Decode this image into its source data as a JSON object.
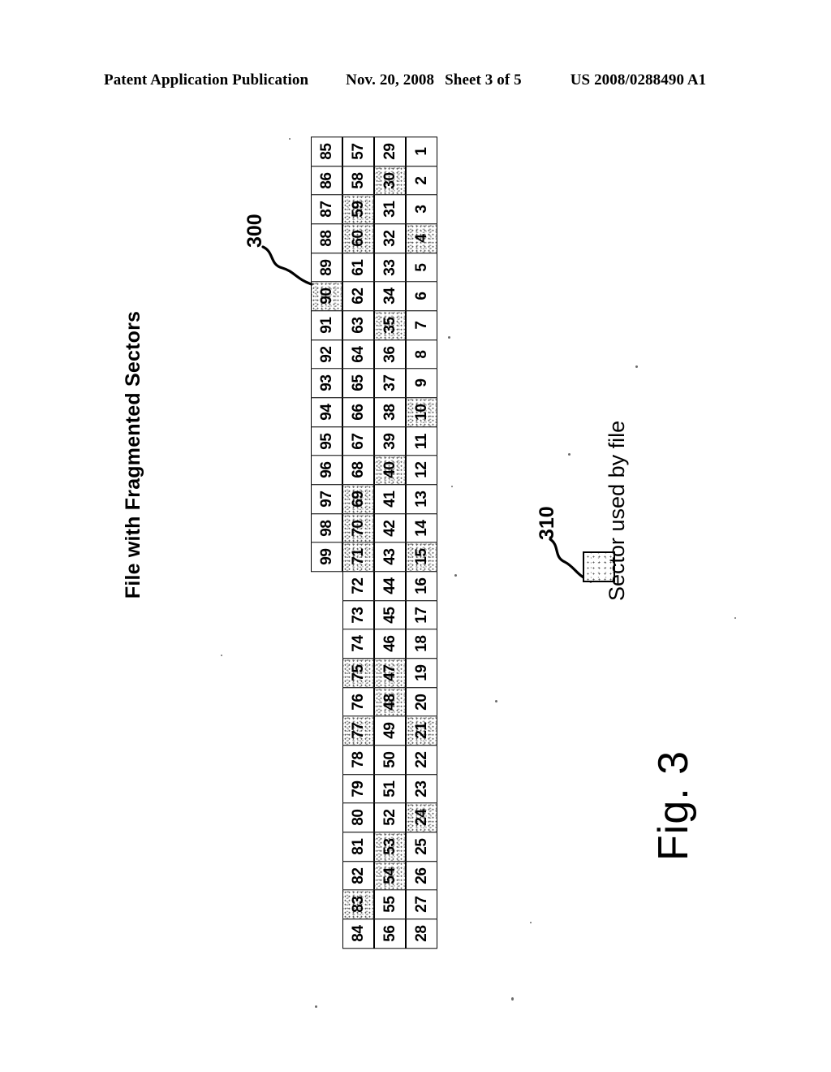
{
  "header": {
    "publication": "Patent Application Publication",
    "date": "Nov. 20, 2008",
    "sheet": "Sheet 3 of 5",
    "patent_number": "US 2008/0288490 A1"
  },
  "figure": {
    "caption": "Fig. 3",
    "title": "File with Fragmented Sectors",
    "ref_grid": "300",
    "ref_legend": "310",
    "legend_label": "Sector used by file"
  },
  "chart_data": {
    "type": "table",
    "title": "File with Fragmented Sectors",
    "description": "Disk sector map, 4 columns of sectors numbered 1-99. Shaded (stippled) cells are sectors used by the file.",
    "columns": 4,
    "rows": 28,
    "column_ranges": [
      {
        "from": 1,
        "to": 28
      },
      {
        "from": 29,
        "to": 56
      },
      {
        "from": 57,
        "to": 84
      },
      {
        "from": 85,
        "to": 99
      }
    ],
    "used_sectors": [
      4,
      10,
      15,
      21,
      24,
      30,
      35,
      40,
      47,
      48,
      53,
      54,
      59,
      60,
      69,
      70,
      71,
      75,
      77,
      83,
      90
    ],
    "grid_rows": [
      {
        "cells": [
          {
            "n": "28",
            "used": false
          },
          {
            "n": "56",
            "used": false
          },
          {
            "n": "84",
            "used": false
          },
          {
            "n": "",
            "used": false,
            "blank": true
          }
        ]
      },
      {
        "cells": [
          {
            "n": "27",
            "used": false
          },
          {
            "n": "55",
            "used": false
          },
          {
            "n": "83",
            "used": true
          },
          {
            "n": "",
            "used": false,
            "blank": true
          }
        ]
      },
      {
        "cells": [
          {
            "n": "26",
            "used": false
          },
          {
            "n": "54",
            "used": true
          },
          {
            "n": "82",
            "used": false
          },
          {
            "n": "",
            "used": false,
            "blank": true
          }
        ]
      },
      {
        "cells": [
          {
            "n": "25",
            "used": false
          },
          {
            "n": "53",
            "used": true
          },
          {
            "n": "81",
            "used": false
          },
          {
            "n": "",
            "used": false,
            "blank": true
          }
        ]
      },
      {
        "cells": [
          {
            "n": "24",
            "used": true
          },
          {
            "n": "52",
            "used": false
          },
          {
            "n": "80",
            "used": false
          },
          {
            "n": "",
            "used": false,
            "blank": true
          }
        ]
      },
      {
        "cells": [
          {
            "n": "23",
            "used": false
          },
          {
            "n": "51",
            "used": false
          },
          {
            "n": "79",
            "used": false
          },
          {
            "n": "",
            "used": false,
            "blank": true
          }
        ]
      },
      {
        "cells": [
          {
            "n": "22",
            "used": false
          },
          {
            "n": "50",
            "used": false
          },
          {
            "n": "78",
            "used": false
          },
          {
            "n": "",
            "used": false,
            "blank": true
          }
        ]
      },
      {
        "cells": [
          {
            "n": "21",
            "used": true
          },
          {
            "n": "49",
            "used": false
          },
          {
            "n": "77",
            "used": true
          },
          {
            "n": "",
            "used": false,
            "blank": true
          }
        ]
      },
      {
        "cells": [
          {
            "n": "20",
            "used": false
          },
          {
            "n": "48",
            "used": true
          },
          {
            "n": "76",
            "used": false
          },
          {
            "n": "",
            "used": false,
            "blank": true
          }
        ]
      },
      {
        "cells": [
          {
            "n": "19",
            "used": false
          },
          {
            "n": "47",
            "used": true
          },
          {
            "n": "75",
            "used": true
          },
          {
            "n": "",
            "used": false,
            "blank": true
          }
        ]
      },
      {
        "cells": [
          {
            "n": "18",
            "used": false
          },
          {
            "n": "46",
            "used": false
          },
          {
            "n": "74",
            "used": false
          },
          {
            "n": "",
            "used": false,
            "blank": true
          }
        ]
      },
      {
        "cells": [
          {
            "n": "17",
            "used": false
          },
          {
            "n": "45",
            "used": false
          },
          {
            "n": "73",
            "used": false
          },
          {
            "n": "",
            "used": false,
            "blank": true
          }
        ]
      },
      {
        "cells": [
          {
            "n": "16",
            "used": false
          },
          {
            "n": "44",
            "used": false
          },
          {
            "n": "72",
            "used": false
          },
          {
            "n": "",
            "used": false,
            "blank": true
          }
        ]
      },
      {
        "cells": [
          {
            "n": "15",
            "used": true
          },
          {
            "n": "43",
            "used": false
          },
          {
            "n": "71",
            "used": true
          },
          {
            "n": "99",
            "used": false
          }
        ]
      },
      {
        "cells": [
          {
            "n": "14",
            "used": false
          },
          {
            "n": "42",
            "used": false
          },
          {
            "n": "70",
            "used": true
          },
          {
            "n": "98",
            "used": false
          }
        ]
      },
      {
        "cells": [
          {
            "n": "13",
            "used": false
          },
          {
            "n": "41",
            "used": false
          },
          {
            "n": "69",
            "used": true
          },
          {
            "n": "97",
            "used": false
          }
        ]
      },
      {
        "cells": [
          {
            "n": "12",
            "used": false
          },
          {
            "n": "40",
            "used": true
          },
          {
            "n": "68",
            "used": false
          },
          {
            "n": "96",
            "used": false
          }
        ]
      },
      {
        "cells": [
          {
            "n": "11",
            "used": false
          },
          {
            "n": "39",
            "used": false
          },
          {
            "n": "67",
            "used": false
          },
          {
            "n": "95",
            "used": false
          }
        ]
      },
      {
        "cells": [
          {
            "n": "10",
            "used": true
          },
          {
            "n": "38",
            "used": false
          },
          {
            "n": "66",
            "used": false
          },
          {
            "n": "94",
            "used": false
          }
        ]
      },
      {
        "cells": [
          {
            "n": "9",
            "used": false
          },
          {
            "n": "37",
            "used": false
          },
          {
            "n": "65",
            "used": false
          },
          {
            "n": "93",
            "used": false
          }
        ]
      },
      {
        "cells": [
          {
            "n": "8",
            "used": false
          },
          {
            "n": "36",
            "used": false
          },
          {
            "n": "64",
            "used": false
          },
          {
            "n": "92",
            "used": false
          }
        ]
      },
      {
        "cells": [
          {
            "n": "7",
            "used": false
          },
          {
            "n": "35",
            "used": true
          },
          {
            "n": "63",
            "used": false
          },
          {
            "n": "91",
            "used": false
          }
        ]
      },
      {
        "cells": [
          {
            "n": "6",
            "used": false
          },
          {
            "n": "34",
            "used": false
          },
          {
            "n": "62",
            "used": false
          },
          {
            "n": "90",
            "used": true
          }
        ]
      },
      {
        "cells": [
          {
            "n": "5",
            "used": false
          },
          {
            "n": "33",
            "used": false
          },
          {
            "n": "61",
            "used": false
          },
          {
            "n": "89",
            "used": false
          }
        ]
      },
      {
        "cells": [
          {
            "n": "4",
            "used": true
          },
          {
            "n": "32",
            "used": false
          },
          {
            "n": "60",
            "used": true
          },
          {
            "n": "88",
            "used": false
          }
        ]
      },
      {
        "cells": [
          {
            "n": "3",
            "used": false
          },
          {
            "n": "31",
            "used": false
          },
          {
            "n": "59",
            "used": true
          },
          {
            "n": "87",
            "used": false
          }
        ]
      },
      {
        "cells": [
          {
            "n": "2",
            "used": false
          },
          {
            "n": "30",
            "used": true
          },
          {
            "n": "58",
            "used": false
          },
          {
            "n": "86",
            "used": false
          }
        ]
      },
      {
        "cells": [
          {
            "n": "1",
            "used": false
          },
          {
            "n": "29",
            "used": false
          },
          {
            "n": "57",
            "used": false
          },
          {
            "n": "85",
            "used": false
          }
        ]
      }
    ]
  }
}
